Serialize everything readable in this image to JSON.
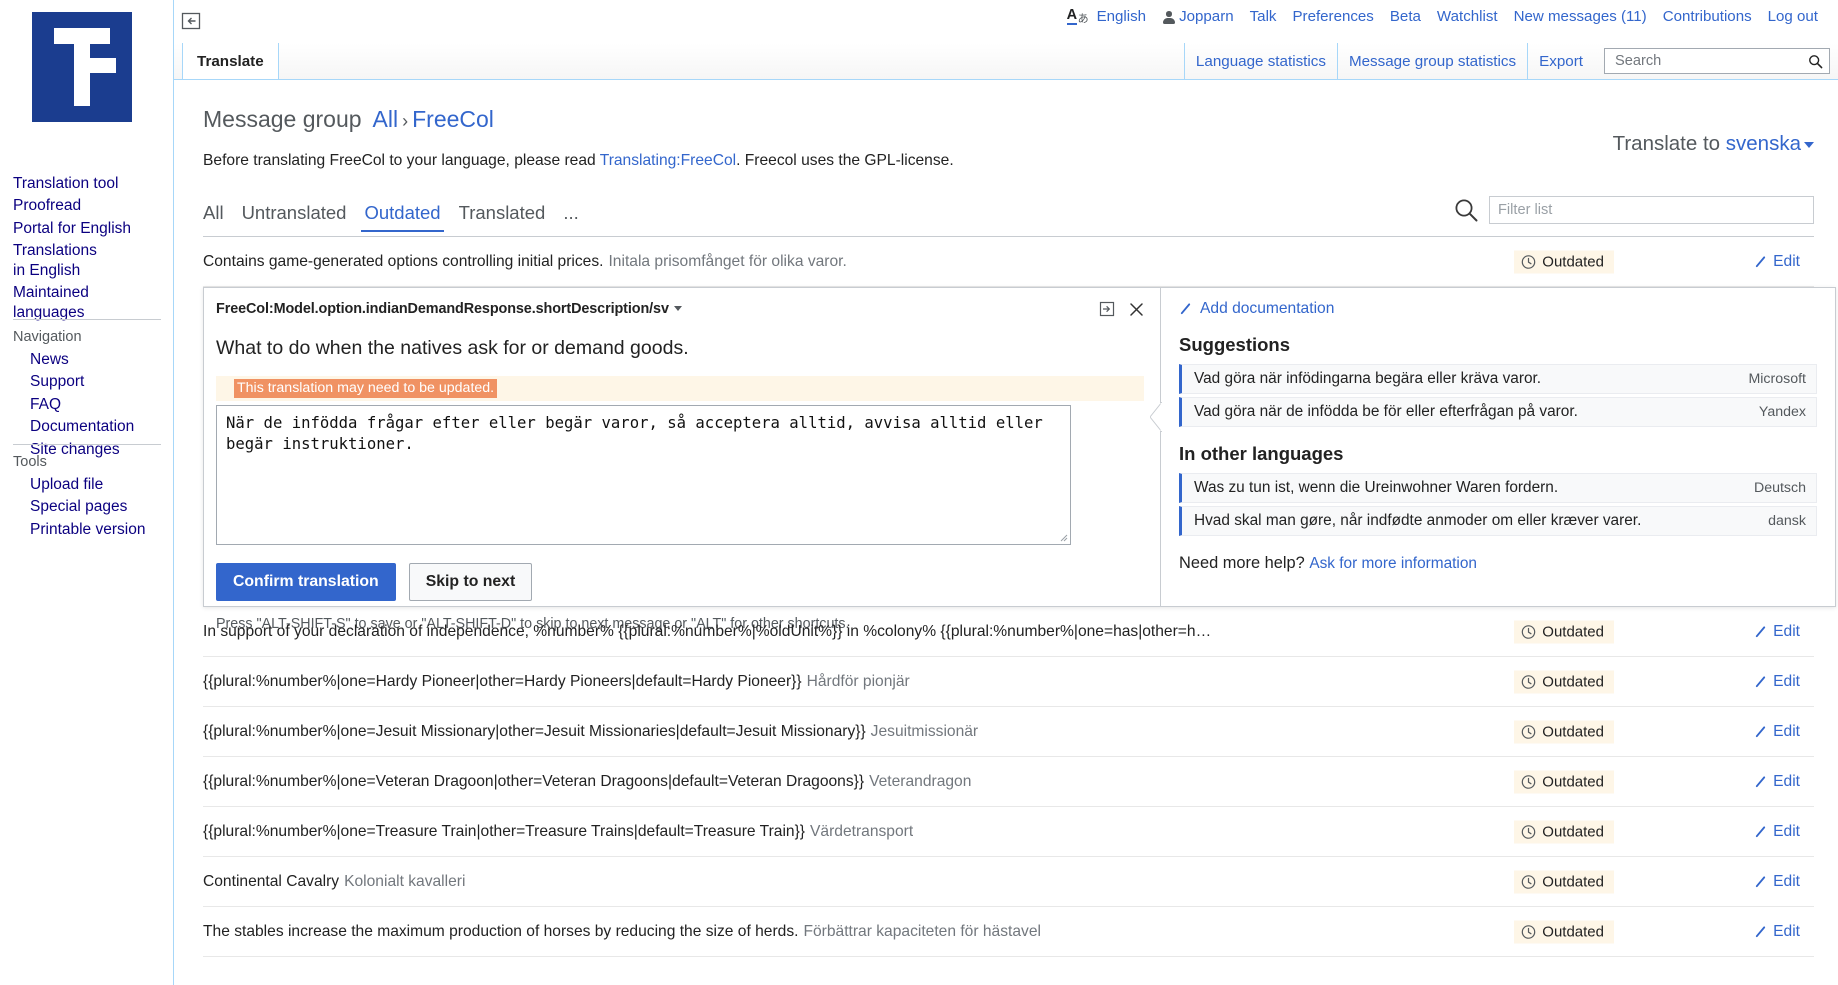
{
  "personal_bar": {
    "language_icon": "uls-language-icon",
    "items": [
      {
        "name": "english-language-link",
        "label": "English"
      },
      {
        "name": "username-link",
        "label": "Jopparn",
        "icon": "user-icon"
      },
      {
        "name": "talk-link",
        "label": "Talk"
      },
      {
        "name": "preferences-link",
        "label": "Preferences"
      },
      {
        "name": "beta-link",
        "label": "Beta"
      },
      {
        "name": "watchlist-link",
        "label": "Watchlist"
      },
      {
        "name": "new-messages-link",
        "label": "New messages (11)"
      },
      {
        "name": "contributions-link",
        "label": "Contributions"
      },
      {
        "name": "logout-link",
        "label": "Log out"
      }
    ]
  },
  "sidebar": {
    "logo_alt": "wikimedia-logo",
    "primary_links": [
      "Translation tool",
      "Proofread",
      "Portal for English",
      "Translations in English",
      "Maintained languages"
    ],
    "sections": [
      {
        "heading": "Navigation",
        "links": [
          "News",
          "Support",
          "FAQ",
          "Documentation",
          "Site changes"
        ]
      },
      {
        "heading": "Tools",
        "links": [
          "Upload file",
          "Special pages",
          "Printable version"
        ]
      }
    ]
  },
  "tabbar": {
    "namespace_tabs": [
      {
        "label": "Translate",
        "selected": true
      }
    ],
    "action_tabs": [
      "Language statistics",
      "Message group statistics",
      "Export"
    ],
    "search": {
      "value": "",
      "placeholder": "Search"
    }
  },
  "main": {
    "message_group_label": "Message group",
    "breadcrumb": {
      "root": "All",
      "separator": "›",
      "current": "FreeCol"
    },
    "translate_to_prefix": "Translate to",
    "translate_to_language": "svenska",
    "description_before": "Before translating FreeCol to your language, please read ",
    "description_link": "Translating:FreeCol",
    "description_after": ". Freecol uses the GPL-license.",
    "filter_tabs": [
      {
        "label": "All",
        "active": false
      },
      {
        "label": "Untranslated",
        "active": false
      },
      {
        "label": "Outdated",
        "active": true
      },
      {
        "label": "Translated",
        "active": false
      },
      {
        "label": "...",
        "active": false
      }
    ],
    "filter_input": {
      "value": "",
      "placeholder": "Filter list"
    },
    "status_label": "Outdated",
    "edit_label": "Edit",
    "rows_above": [
      {
        "source": "Contains game-generated options controlling initial prices.",
        "translation": "Initala prisomfånget för olika varor."
      }
    ],
    "rows_below": [
      {
        "source": "In support of your declaration of independence, %number% {{plural:%number%|%oldUnit%}} in %colony% {{plural:%number%|one=has|other=h…",
        "translation": ""
      },
      {
        "source": "{{plural:%number%|one=Hardy Pioneer|other=Hardy Pioneers|default=Hardy Pioneer}}",
        "translation": "Hårdför pionjär"
      },
      {
        "source": "{{plural:%number%|one=Jesuit Missionary|other=Jesuit Missionaries|default=Jesuit Missionary}}",
        "translation": "Jesuitmissionär"
      },
      {
        "source": "{{plural:%number%|one=Veteran Dragoon|other=Veteran Dragoons|default=Veteran Dragoons}}",
        "translation": "Veterandragon"
      },
      {
        "source": "{{plural:%number%|one=Treasure Train|other=Treasure Trains|default=Treasure Train}}",
        "translation": "Värdetransport"
      },
      {
        "source": "Continental Cavalry",
        "translation": "Kolonialt kavalleri"
      },
      {
        "source": "The stables increase the maximum production of horses by reducing the size of herds.",
        "translation": "Förbättrar kapaciteten för hästavel"
      }
    ]
  },
  "editor": {
    "title": "FreeCol:Model.option.indianDemandResponse.shortDescription/sv",
    "expand_icon": "expand-icon",
    "close_icon": "close-icon",
    "source_text": "What to do when the natives ask for or demand goods.",
    "fuzzy_notice": "This translation may need to be updated.",
    "translation_value": "När de infödda frågar efter eller begär varor, så acceptera alltid, avvisa alltid eller begär instruktioner.",
    "confirm_button": "Confirm translation",
    "skip_button": "Skip to next",
    "hint": "Press \"ALT-SHIFT-S\" to save or \"ALT-SHIFT-D\" to skip to next message or \"ALT\" for other shortcuts.",
    "add_documentation": "Add documentation",
    "suggestions_heading": "Suggestions",
    "suggestions": [
      {
        "text": "Vad göra när infödingarna begära eller kräva varor.",
        "source": "Microsoft"
      },
      {
        "text": "Vad göra när de infödda be för eller efterfrågan på varor.",
        "source": "Yandex"
      }
    ],
    "other_languages_heading": "In other languages",
    "other_languages": [
      {
        "text": "Was zu tun ist, wenn die Ureinwohner Waren fordern.",
        "source": "Deutsch"
      },
      {
        "text": "Hvad skal man gøre, når indfødte anmoder om eller kræver varer.",
        "source": "dansk"
      }
    ],
    "need_help_label": "Need more help?",
    "need_help_link": "Ask for more information"
  },
  "colors": {
    "link": "#3366cc",
    "visited_link": "#0b0080",
    "outdated_badge_bg": "#fef6e7",
    "fuzzy_highlight": "#f09263",
    "primary_button": "#3366cc",
    "border": "#a7d7f9"
  }
}
